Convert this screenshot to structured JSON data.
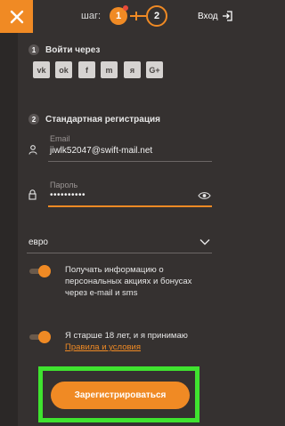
{
  "header": {
    "step_label": "шаг:",
    "step1": "1",
    "step2": "2",
    "login_label": "Вход"
  },
  "social": {
    "number": "1",
    "title": "Войти через",
    "buttons": [
      "vk",
      "ok",
      "f",
      "m",
      "я",
      "G+"
    ]
  },
  "registration": {
    "number": "2",
    "title": "Стандартная регистрация",
    "email_label": "Email",
    "email_value": "jiwlk52047@swift-mail.net",
    "password_label": "Пароль",
    "password_value": "••••••••••",
    "currency_value": "евро"
  },
  "options": {
    "promo_text_1": "Получать информацию о",
    "promo_text_2": "персональных акциях и бонусах",
    "promo_text_3": "через e-mail и sms",
    "age_text": "Я старше 18 лет, и я принимаю",
    "terms_link": "Правила и условия"
  },
  "submit_label": "Зарегистрироваться",
  "colors": {
    "accent": "#f08a24",
    "background": "#353130",
    "highlight": "#3fe32f"
  }
}
